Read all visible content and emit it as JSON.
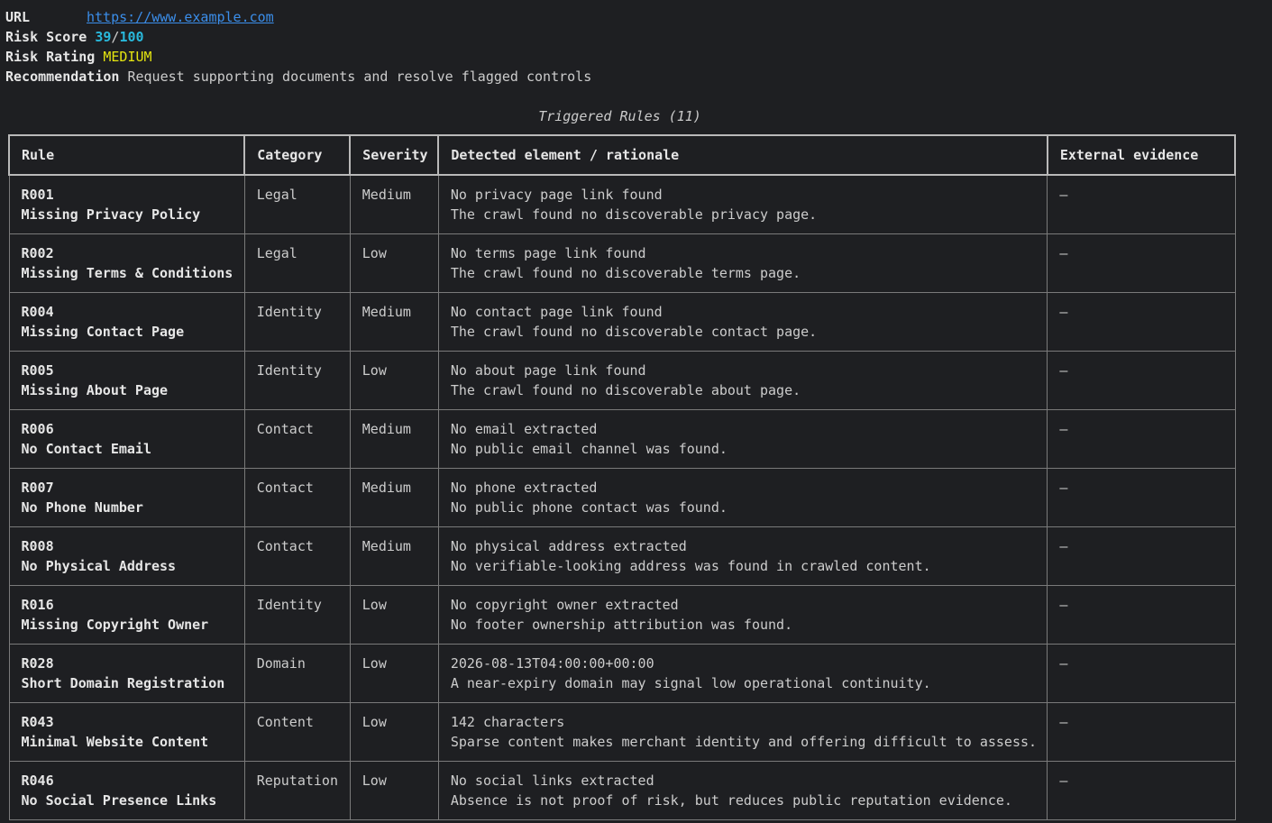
{
  "meta": {
    "url_label": "URL",
    "url": "https://www.example.com",
    "risk_score_label": "Risk Score",
    "risk_score": "39",
    "risk_score_sep": "/",
    "risk_score_max": "100",
    "risk_rating_label": "Risk Rating",
    "risk_rating": "MEDIUM",
    "recommendation_label": "Recommendation",
    "recommendation": "Request supporting documents and resolve flagged controls"
  },
  "table": {
    "title": "Triggered Rules (11)",
    "headers": [
      "Rule",
      "Category",
      "Severity",
      "Detected element / rationale",
      "External evidence"
    ],
    "rows": [
      {
        "id": "R001",
        "name": "Missing Privacy Policy",
        "category": "Legal",
        "severity": "Medium",
        "detected": "No privacy page link found",
        "rationale": "The crawl found no discoverable privacy page.",
        "evidence": "—"
      },
      {
        "id": "R002",
        "name": "Missing Terms & Conditions",
        "category": "Legal",
        "severity": "Low",
        "detected": "No terms page link found",
        "rationale": "The crawl found no discoverable terms page.",
        "evidence": "—"
      },
      {
        "id": "R004",
        "name": "Missing Contact Page",
        "category": "Identity",
        "severity": "Medium",
        "detected": "No contact page link found",
        "rationale": "The crawl found no discoverable contact page.",
        "evidence": "—"
      },
      {
        "id": "R005",
        "name": "Missing About Page",
        "category": "Identity",
        "severity": "Low",
        "detected": "No about page link found",
        "rationale": "The crawl found no discoverable about page.",
        "evidence": "—"
      },
      {
        "id": "R006",
        "name": "No Contact Email",
        "category": "Contact",
        "severity": "Medium",
        "detected": "No email extracted",
        "rationale": "No public email channel was found.",
        "evidence": "—"
      },
      {
        "id": "R007",
        "name": "No Phone Number",
        "category": "Contact",
        "severity": "Medium",
        "detected": "No phone extracted",
        "rationale": "No public phone contact was found.",
        "evidence": "—"
      },
      {
        "id": "R008",
        "name": "No Physical Address",
        "category": "Contact",
        "severity": "Medium",
        "detected": "No physical address extracted",
        "rationale": "No verifiable-looking address was found in crawled content.",
        "evidence": "—"
      },
      {
        "id": "R016",
        "name": "Missing Copyright Owner",
        "category": "Identity",
        "severity": "Low",
        "detected": "No copyright owner extracted",
        "rationale": "No footer ownership attribution was found.",
        "evidence": "—"
      },
      {
        "id": "R028",
        "name": "Short Domain Registration",
        "category": "Domain",
        "severity": "Low",
        "detected": "2026-08-13T04:00:00+00:00",
        "rationale": "A near-expiry domain may signal low operational continuity.",
        "evidence": "—"
      },
      {
        "id": "R043",
        "name": "Minimal Website Content",
        "category": "Content",
        "severity": "Low",
        "detected": "142 characters",
        "rationale": "Sparse content makes merchant identity and offering difficult to assess.",
        "evidence": "—"
      },
      {
        "id": "R046",
        "name": "No Social Presence Links",
        "category": "Reputation",
        "severity": "Low",
        "detected": "No social links extracted",
        "rationale": "Absence is not proof of risk, but reduces public reputation evidence.",
        "evidence": "—"
      }
    ]
  }
}
